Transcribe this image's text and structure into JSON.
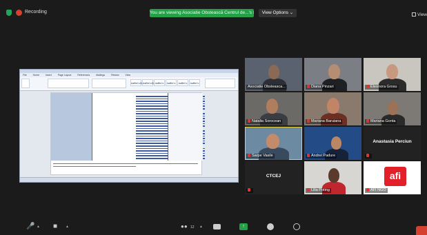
{
  "topbar": {
    "recording_label": "Recording",
    "share_banner": "You are viewing Asociatie Obstească Centrul de...'s screen",
    "view_options_label": "View Options ⌄",
    "view_label": "View"
  },
  "document": {
    "menus": [
      "File",
      "Home",
      "Insert",
      "Page Layout",
      "References",
      "Mailings",
      "Review",
      "View"
    ],
    "styles": [
      "AaBbCcDc",
      "AaBbCcDc",
      "AaBbCc",
      "AaBbCc",
      "AaBbCc",
      "AaBbCc"
    ]
  },
  "participants": [
    {
      "name": "Asociatie Obsteasca...",
      "muted": false
    },
    {
      "name": "Diana Pinzari",
      "muted": true
    },
    {
      "name": "Eleonora Grosu",
      "muted": true
    },
    {
      "name": "Natalia Sorocean",
      "muted": true
    },
    {
      "name": "Mariana Baruiana",
      "muted": true
    },
    {
      "name": "Mariana Gonta",
      "muted": true
    },
    {
      "name": "Sarpe Vasile",
      "muted": true
    },
    {
      "name": "Andrei Padure",
      "muted": true
    },
    {
      "name": "Anastasia Perciun",
      "muted": true
    },
    {
      "name": "CTCEJ",
      "muted": false
    },
    {
      "name": "Lilia Poting",
      "muted": true
    },
    {
      "name": "AFI NGO",
      "muted": true
    }
  ],
  "logos": {
    "afi": "afi"
  },
  "toolbar": {
    "participants_count": "12"
  },
  "colors": {
    "share_green": "#24a148",
    "record_red": "#d6402f",
    "active_speaker": "#e5d44a"
  }
}
